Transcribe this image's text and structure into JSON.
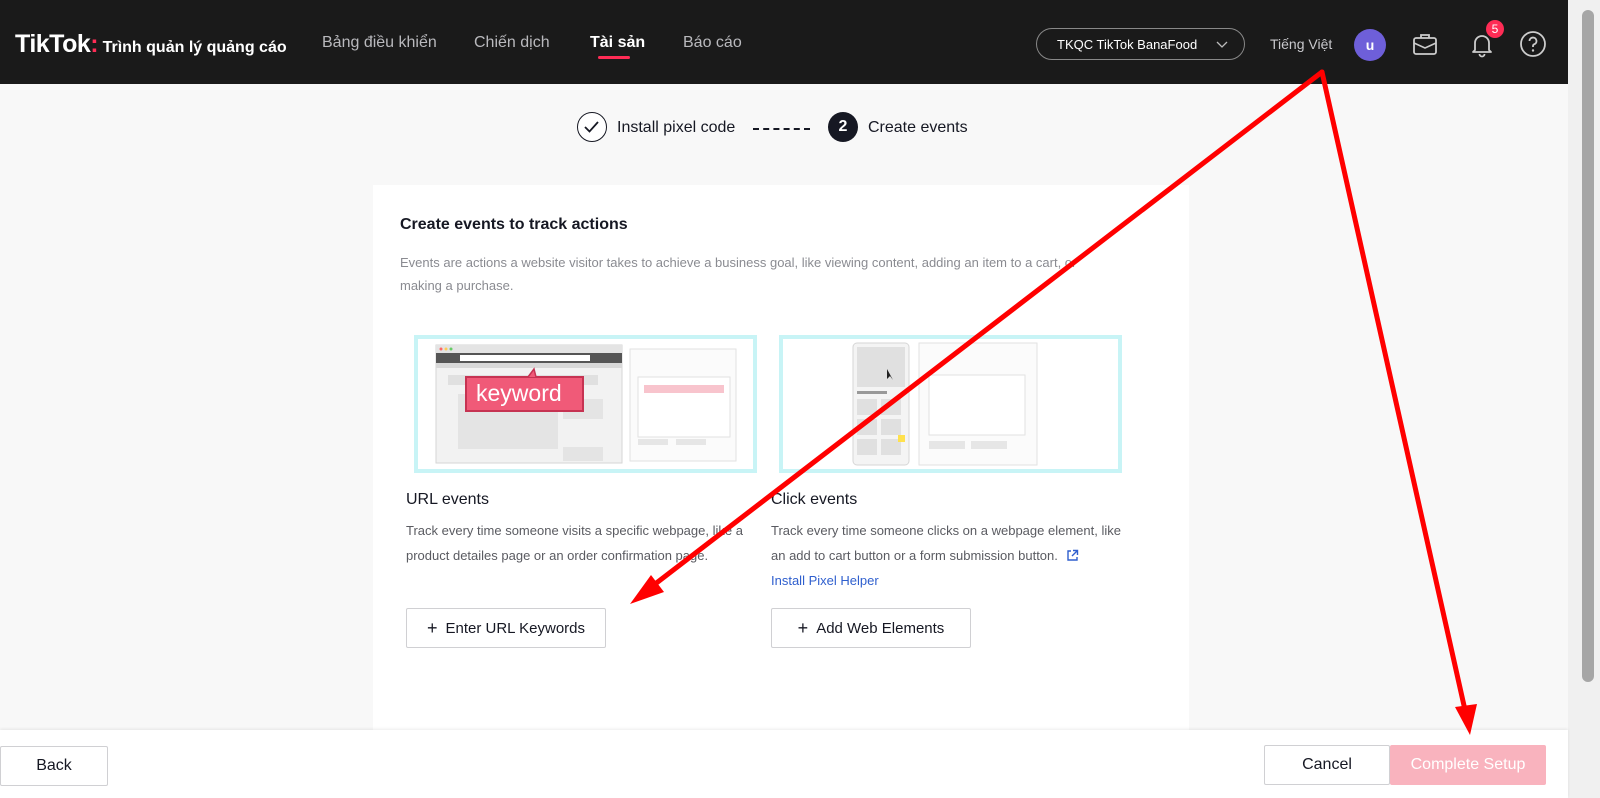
{
  "app": {
    "logo_main": "TikTok",
    "logo_dot": ":",
    "logo_sub": "Trình quản lý quảng cáo"
  },
  "nav": {
    "items": [
      {
        "label": "Bảng điều khiển",
        "active": false
      },
      {
        "label": "Chiến dịch",
        "active": false
      },
      {
        "label": "Tài sản",
        "active": true
      },
      {
        "label": "Báo cáo",
        "active": false
      }
    ]
  },
  "header": {
    "account": "TKQC TikTok BanaFood",
    "language": "Tiếng Việt",
    "avatar_initial": "u",
    "notification_count": "5",
    "icons": [
      "briefcase-icon",
      "bell-icon",
      "help-icon",
      "chevron-down-icon"
    ]
  },
  "stepper": {
    "step1_label": "Install pixel code",
    "step2_number": "2",
    "step2_label": "Create events"
  },
  "card": {
    "title": "Create events to track actions",
    "description": "Events are actions a website visitor takes to achieve a business goal, like viewing content, adding an item to a cart, or making a purchase.",
    "url_events": {
      "illustration_keyword": "keyword",
      "title": "URL events",
      "description": "Track every time someone visits a specific webpage, like a product detailes page or an order confirmation page.",
      "button": "Enter URL Keywords"
    },
    "click_events": {
      "title": "Click events",
      "description": "Track every time someone clicks on a webpage element, like an add to cart button or a form submission button.",
      "link": "Install Pixel Helper",
      "button": "Add Web Elements"
    }
  },
  "footer": {
    "back": "Back",
    "cancel": "Cancel",
    "complete": "Complete Setup"
  },
  "colors": {
    "brand": "#fe2c55",
    "topbar": "#1a1a1a",
    "complete_disabled": "#f9b3be",
    "annotation_arrow": "#ff0000",
    "link": "#2f5fce"
  }
}
